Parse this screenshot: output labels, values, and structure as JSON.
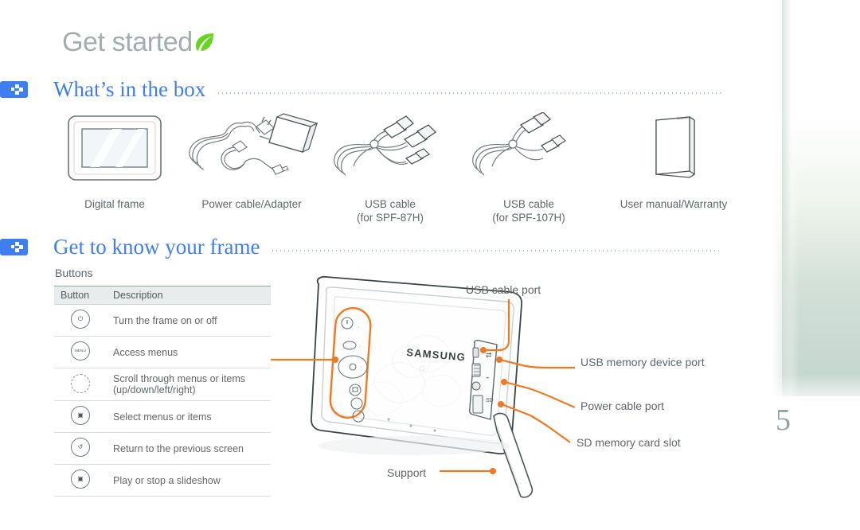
{
  "page": {
    "title": "Get started",
    "leaf_icon": "leaf-icon",
    "number": "5"
  },
  "sections": [
    {
      "id": "whats-in-the-box",
      "title": "What’s in the box",
      "badge_icon": "arrow-blocks-icon"
    },
    {
      "id": "get-to-know-your-frame",
      "title": "Get to know your frame",
      "badge_icon": "arrow-blocks-icon"
    }
  ],
  "box_items": [
    {
      "icon": "digital-frame-icon",
      "caption": "Digital frame",
      "caption2": ""
    },
    {
      "icon": "power-cable-adapter-icon",
      "caption": "Power cable/Adapter",
      "caption2": ""
    },
    {
      "icon": "usb-cable-icon",
      "caption": "USB cable",
      "caption2": "(for SPF-87H)"
    },
    {
      "icon": "usb-cable-icon",
      "caption": "USB cable",
      "caption2": "(for SPF-107H)"
    },
    {
      "icon": "user-manual-icon",
      "caption": "User manual/Warranty",
      "caption2": ""
    }
  ],
  "buttons_table": {
    "label": "Buttons",
    "headers": {
      "button": "Button",
      "description": "Description"
    },
    "rows": [
      {
        "icon": "power-button-icon",
        "glyph": "⏻",
        "description": "Turn the frame on or off",
        "description2": ""
      },
      {
        "icon": "menu-button-icon",
        "glyph": "MENU",
        "description": "Access menus",
        "description2": ""
      },
      {
        "icon": "navigation-pad-icon",
        "glyph": "",
        "description": "Scroll through menus or items",
        "description2": "(up/down/left/right)"
      },
      {
        "icon": "select-button-icon",
        "glyph": "▣",
        "description": "Select menus or items",
        "description2": ""
      },
      {
        "icon": "return-button-icon",
        "glyph": "↺",
        "description": "Return to the previous screen",
        "description2": ""
      },
      {
        "icon": "slideshow-button-icon",
        "glyph": "▶",
        "description": "Play or stop a slideshow",
        "description2": ""
      }
    ]
  },
  "product": {
    "brand": "SAMSUNG",
    "callouts": [
      {
        "id": "usb-cable-port",
        "label": "USB cable port"
      },
      {
        "id": "usb-memory-device-port",
        "label": "USB memory device port"
      },
      {
        "id": "power-cable-port",
        "label": "Power cable port"
      },
      {
        "id": "sd-memory-card-slot",
        "label": "SD memory card slot"
      },
      {
        "id": "support",
        "label": "Support"
      }
    ]
  },
  "colors": {
    "heading_blue": "#3d7ff0",
    "title_gray": "#a3adb0",
    "callout_orange": "#f07a22",
    "leaf_green": "#63d61d",
    "body_text": "#5d686e"
  }
}
